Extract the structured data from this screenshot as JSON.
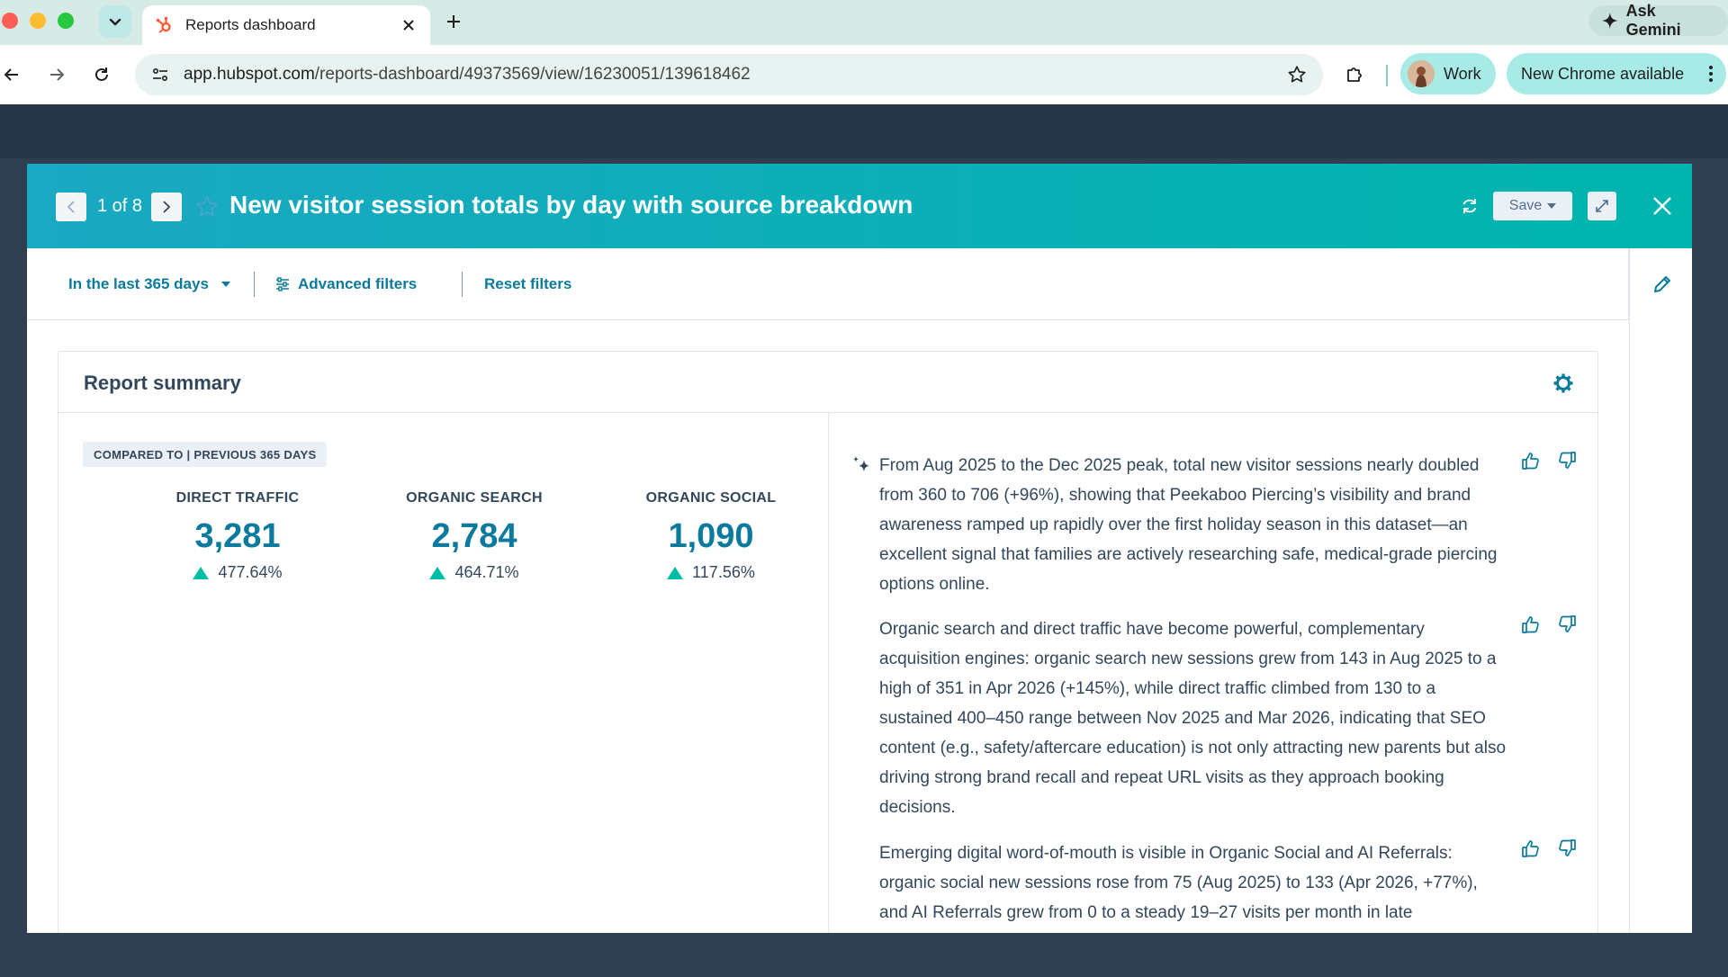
{
  "browser": {
    "tab_title": "Reports dashboard",
    "url_host": "app.hubspot.com",
    "url_path": "/reports-dashboard/49373569/view/16230051/139618462",
    "ask_gemini": "Ask Gemini",
    "profile_name": "Work",
    "new_chrome": "New Chrome available"
  },
  "modal": {
    "pager": "1 of 8",
    "title": "New visitor session totals by day with source breakdown",
    "save_label": "Save",
    "filters": {
      "date_range": "In the last 365 days",
      "advanced": "Advanced filters",
      "reset": "Reset filters"
    },
    "summary": {
      "title": "Report summary",
      "compare_tag": "COMPARED TO | PREVIOUS 365 DAYS",
      "metrics": [
        {
          "label": "DIRECT TRAFFIC",
          "value": "3,281",
          "change": "477.64%"
        },
        {
          "label": "ORGANIC SEARCH",
          "value": "2,784",
          "change": "464.71%"
        },
        {
          "label": "ORGANIC SOCIAL",
          "value": "1,090",
          "change": "117.56%"
        }
      ],
      "insights": [
        "From Aug 2025 to the Dec 2025 peak, total new visitor sessions nearly doubled from 360 to 706 (+96%), showing that Peekaboo Piercing’s visibility and brand awareness ramped up rapidly over the first holiday season in this dataset—an excellent signal that families are actively researching safe, medical-grade piercing options online.",
        "Organic search and direct traffic have become powerful, complementary acquisition engines: organic search new sessions grew from 143 in Aug 2025 to a high of 351 in Apr 2026 (+145%), while direct traffic climbed from 130 to a sustained 400–450 range between Nov 2025 and Mar 2026, indicating that SEO content (e.g., safety/aftercare education) is not only attracting new parents but also driving strong brand recall and repeat URL visits as they approach booking decisions.",
        "Emerging digital word-of-mouth is visible in Organic Social and AI Referrals: organic social new sessions rose from 75 (Aug 2025) to 133 (Apr 2026, +77%), and AI Referrals grew from 0 to a steady 19–27 visits per month in late"
      ]
    }
  },
  "colors": {
    "header_start": "#1aa8c2",
    "header_end": "#00b5ad",
    "link": "#0b7a9c",
    "positive": "#00bda5"
  }
}
